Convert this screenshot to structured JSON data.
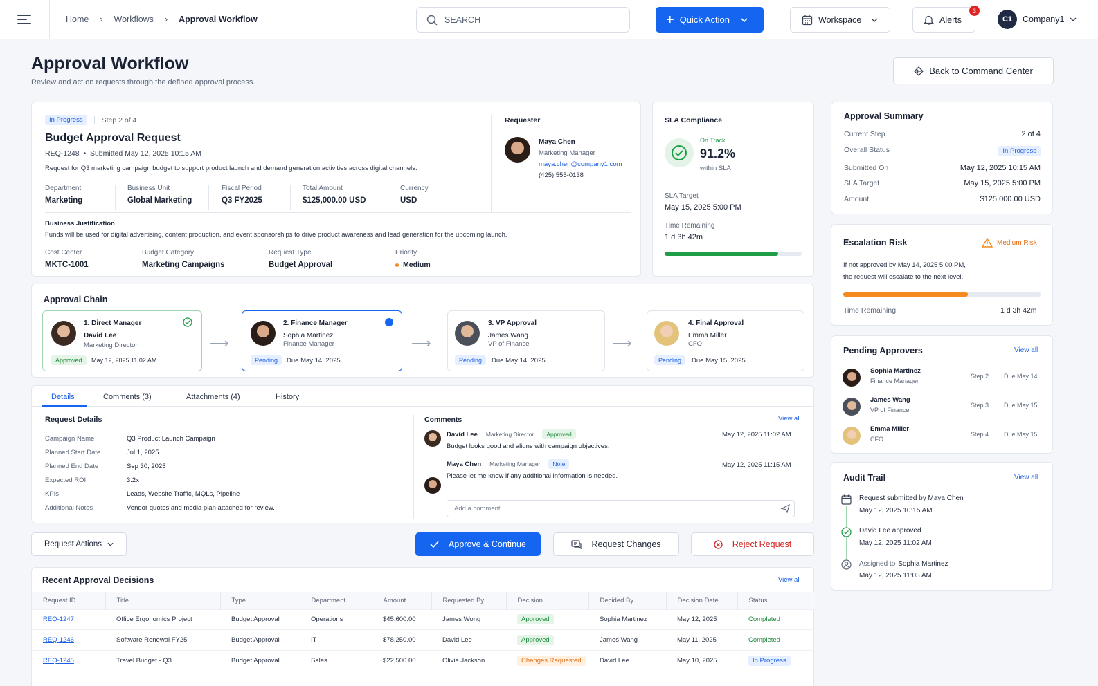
{
  "breadcrumb": {
    "home": "Home",
    "workflows": "Workflows",
    "current": "Approval Workflow"
  },
  "search": {
    "placeholder": "SEARCH"
  },
  "top": {
    "quick_action": "Quick Action",
    "workspace": "Workspace",
    "alerts": "Alerts",
    "alerts_count": "3",
    "company_initials": "C1",
    "company": "Company1"
  },
  "page": {
    "title": "Approval Workflow",
    "subtitle": "Review and act on requests through the defined approval process.",
    "back_button": "Back to Command Center"
  },
  "request": {
    "status_badge": "In Progress",
    "step": "Step 2 of 4",
    "title": "Budget Approval Request",
    "meta": "REQ-1248  •  Submitted May 12, 2025 10:15 AM",
    "description": "Request for Q3 marketing campaign budget to support product launch and demand generation activities across digital channels.",
    "fields": [
      {
        "label": "Department",
        "value": "Marketing"
      },
      {
        "label": "Business Unit",
        "value": "Global Marketing"
      },
      {
        "label": "Fiscal Period",
        "value": "Q3 FY2025"
      },
      {
        "label": "Total Amount",
        "value": "$125,000.00 USD"
      },
      {
        "label": "Currency",
        "value": "USD"
      }
    ],
    "justification_title": "Business Justification",
    "justification": "Funds will be used for digital advertising, content production, and event sponsorships to drive product awareness and lead generation for the upcoming launch.",
    "fields2": [
      {
        "label": "Cost Center",
        "value": "MKTC-1001"
      },
      {
        "label": "Budget Category",
        "value": "Marketing Campaigns"
      },
      {
        "label": "Request Type",
        "value": "Budget Approval"
      },
      {
        "label": "Priority",
        "value": "Medium"
      }
    ],
    "requester_title": "Requester",
    "requester": {
      "name": "Maya Chen",
      "role": "Marketing Manager",
      "email": "maya.chen@company1.com",
      "phone": "(425) 555-0138"
    }
  },
  "sla": {
    "title": "SLA Compliance",
    "status": "On Track",
    "percent": "91.2%",
    "percent_value": 91.2,
    "within": "within SLA",
    "target_label": "SLA Target",
    "target": "May 15, 2025 5:00 PM",
    "remaining_label": "Time Remaining",
    "remaining": "1 d 3h 42m",
    "progress": 0.83,
    "color": "#1f9d47"
  },
  "summary": {
    "title": "Approval Summary",
    "rows": [
      {
        "label": "Current Step",
        "value": "2 of 4"
      },
      {
        "label": "Overall Status",
        "value": "In Progress"
      },
      {
        "label": "Submitted On",
        "value": "May 12, 2025 10:15 AM"
      },
      {
        "label": "SLA Target",
        "value": "May 15, 2025 5:00 PM"
      },
      {
        "label": "Amount",
        "value": "$125,000.00 USD"
      }
    ]
  },
  "escalation": {
    "title": "Escalation Risk",
    "risk": "Medium Risk",
    "text1": "If not approved by May 14, 2025 5:00 PM,",
    "text2": "the request will escalate to the next level.",
    "remaining_label": "Time Remaining",
    "remaining": "1 d 3h 42m",
    "progress": 0.63,
    "color": "#f58a1f"
  },
  "chain": {
    "title": "Approval Chain",
    "steps": [
      {
        "title": "1. Direct Manager",
        "name": "David Lee",
        "role": "Marketing Director",
        "status": "Approved",
        "date": "May 12, 2025 11:02 AM"
      },
      {
        "title": "2. Finance Manager",
        "name": "Sophia Martinez",
        "role": "Finance Manager",
        "status": "Pending",
        "date": "Due May 14, 2025"
      },
      {
        "title": "3. VP Approval",
        "name": "James Wang",
        "role": "VP of Finance",
        "status": "Pending",
        "date": "Due May 14, 2025"
      },
      {
        "title": "4. Final Approval",
        "name": "Emma Miller",
        "role": "CFO",
        "status": "Pending",
        "date": "Due May 15, 2025"
      }
    ]
  },
  "pending": {
    "title": "Pending Approvers",
    "view_all": "View all",
    "items": [
      {
        "name": "Sophia Martinez",
        "role": "Finance Manager",
        "step": "Step 2",
        "due": "Due May 14"
      },
      {
        "name": "James Wang",
        "role": "VP of Finance",
        "step": "Step 3",
        "due": "Due May 15"
      },
      {
        "name": "Emma Miller",
        "role": "CFO",
        "step": "Step 4",
        "due": "Due May 15"
      }
    ]
  },
  "audit": {
    "title": "Audit Trail",
    "view_all": "View all",
    "items": [
      {
        "text": "Request submitted by Maya Chen",
        "date": "May 12, 2025 10:15 AM"
      },
      {
        "text": "David Lee approved",
        "date": "May 12, 2025 11:02 AM"
      },
      {
        "text_pre": "Assigned to",
        "text": "Sophia Martinez",
        "date": "May 12, 2025 11:03 AM"
      }
    ]
  },
  "tabs": [
    "Details",
    "Comments (3)",
    "Attachments (4)",
    "History"
  ],
  "details": {
    "title": "Request Details",
    "rows": [
      {
        "label": "Campaign Name",
        "value": "Q3 Product Launch Campaign"
      },
      {
        "label": "Planned Start Date",
        "value": "Jul 1, 2025"
      },
      {
        "label": "Planned End Date",
        "value": "Sep 30, 2025"
      },
      {
        "label": "Expected ROI",
        "value": "3.2x"
      },
      {
        "label": "KPIs",
        "value": "Leads, Website Traffic, MQLs, Pipeline"
      },
      {
        "label": "Additional Notes",
        "value": "Vendor quotes and media plan attached for review."
      }
    ]
  },
  "comments": {
    "title": "Comments",
    "view_all": "View all",
    "items": [
      {
        "name": "David Lee",
        "role": "Marketing Director",
        "tag": "Approved",
        "date": "May 12, 2025 11:02 AM",
        "text": "Budget looks good and aligns with campaign objectives."
      },
      {
        "name": "Maya Chen",
        "role": "Marketing Manager",
        "tag": "Note",
        "date": "May 12, 2025 11:15 AM",
        "text": "Please let me know if any additional information is needed."
      }
    ],
    "placeholder": "Add a comment..."
  },
  "actions": {
    "request_actions": "Request Actions",
    "approve": "Approve & Continue",
    "changes": "Request Changes",
    "reject": "Reject Request"
  },
  "recent": {
    "title": "Recent Approval Decisions",
    "view_all": "View all",
    "columns": [
      "Request ID",
      "Title",
      "Type",
      "Department",
      "Amount",
      "Requested By",
      "Decision",
      "Decided By",
      "Decision Date",
      "Status"
    ],
    "rows": [
      {
        "id": "REQ-1247",
        "title": "Office Ergonomics Project",
        "type": "Budget Approval",
        "dept": "Operations",
        "amount": "$45,600.00",
        "by": "James Wong",
        "decision": "Approved",
        "decided": "Sophia Martinez",
        "date": "May 12, 2025",
        "status": "Completed"
      },
      {
        "id": "REQ-1246",
        "title": "Software Renewal FY25",
        "type": "Budget Approval",
        "dept": "IT",
        "amount": "$78,250.00",
        "by": "David Lee",
        "decision": "Approved",
        "decided": "James Wang",
        "date": "May 11, 2025",
        "status": "Completed"
      },
      {
        "id": "REQ-1245",
        "title": "Travel Budget - Q3",
        "type": "Budget Approval",
        "dept": "Sales",
        "amount": "$22,500.00",
        "by": "Olivia Jackson",
        "decision": "Changes Requested",
        "decided": "David Lee",
        "date": "May 10, 2025",
        "status": "In Progress"
      }
    ]
  }
}
